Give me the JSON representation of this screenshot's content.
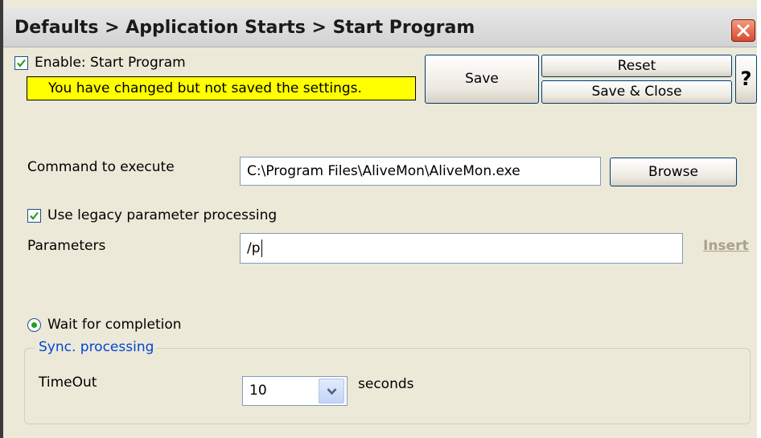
{
  "window": {
    "title": "Defaults > Application Starts > Start Program"
  },
  "header": {
    "enable_label": "Enable: Start Program",
    "enable_checked": true,
    "warning": "You have changed but not saved the settings.",
    "save_label": "Save",
    "reset_label": "Reset",
    "save_close_label": "Save & Close",
    "help_label": "?"
  },
  "form": {
    "command_label": "Command to execute",
    "command_value": "C:\\Program Files\\AliveMon\\AliveMon.exe",
    "browse_label": "Browse",
    "legacy_label": "Use legacy parameter processing",
    "legacy_checked": true,
    "parameters_label": "Parameters",
    "parameters_value": "/p",
    "insert_label": "Insert",
    "wait_label": "Wait for completion",
    "wait_selected": true,
    "sync_group_label": "Sync. processing",
    "timeout_label": "TimeOut",
    "timeout_value": "10",
    "seconds_label": "seconds"
  },
  "icons": {
    "close": "close-icon",
    "check": "check-icon",
    "dropdown": "chevron-down-icon"
  },
  "colors": {
    "warning_bg": "#ffff00",
    "group_legend": "#0046d5",
    "insert_disabled": "#a9a28b",
    "check_green": "#21a121",
    "close_red": "#d94a2a"
  }
}
